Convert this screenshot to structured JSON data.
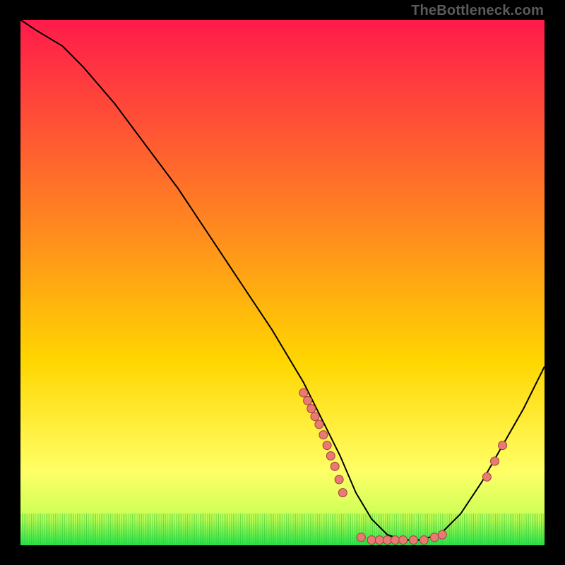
{
  "watermark": "TheBottleneck.com",
  "colors": {
    "gradient_top": "#ff1a4b",
    "gradient_mid": "#ffd000",
    "gradient_low": "#ffff55",
    "gradient_bottom": "#28e64a",
    "curve": "#000000",
    "marker_fill": "#e77a72",
    "marker_stroke": "#a33f3f",
    "green_tick": "#20c23a"
  },
  "chart_data": {
    "type": "line",
    "title": "",
    "xlabel": "",
    "ylabel": "",
    "xlim": [
      0,
      100
    ],
    "ylim": [
      0,
      100
    ],
    "series": [
      {
        "name": "bottleneck-curve",
        "x": [
          0,
          3,
          8,
          12,
          18,
          24,
          30,
          36,
          42,
          48,
          54,
          58,
          61,
          64,
          67,
          70,
          73,
          76,
          80,
          84,
          88,
          92,
          96,
          100
        ],
        "y": [
          100,
          98,
          95,
          91,
          84,
          76,
          68,
          59,
          50,
          41,
          31,
          23,
          17,
          10,
          5,
          2,
          1,
          1,
          2,
          6,
          12,
          19,
          26,
          34
        ]
      }
    ],
    "markers_left_branch_x": [
      54,
      54.8,
      55.5,
      56.2,
      57,
      57.8,
      58.5,
      59.2,
      60,
      60.8,
      61.5
    ],
    "markers_left_branch_y": [
      29,
      27.5,
      26,
      24.5,
      23,
      21,
      19,
      17,
      15,
      12.5,
      10
    ],
    "markers_bottom_x": [
      65,
      67,
      68.5,
      70,
      71.5,
      73,
      75,
      77,
      79,
      80.5
    ],
    "markers_bottom_y": [
      1.5,
      1,
      1,
      1,
      1,
      1,
      1,
      1,
      1.5,
      2
    ],
    "markers_right_branch_x": [
      89,
      90.5,
      92
    ],
    "markers_right_branch_y": [
      13,
      16,
      19
    ],
    "green_tick_band_y": [
      0,
      6
    ]
  }
}
